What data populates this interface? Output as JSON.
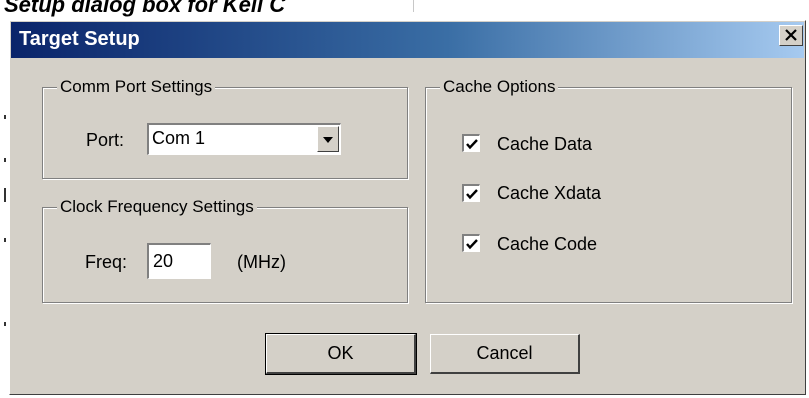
{
  "page": {
    "heading": "Setup dialog box for Keil C"
  },
  "dialog": {
    "title": "Target Setup",
    "close_glyph": "✕"
  },
  "comm_port": {
    "group_label": "Comm Port Settings",
    "port_label": "Port:",
    "port_value": "Com 1"
  },
  "clock": {
    "group_label": "Clock Frequency Settings",
    "freq_label": "Freq:",
    "freq_value": "20",
    "unit": "(MHz)"
  },
  "cache": {
    "group_label": "Cache Options",
    "options": [
      {
        "label": "Cache Data",
        "checked": true
      },
      {
        "label": "Cache Xdata",
        "checked": true
      },
      {
        "label": "Cache Code",
        "checked": true
      }
    ]
  },
  "buttons": {
    "ok_label": "OK",
    "cancel_label": "Cancel"
  },
  "colors": {
    "face": "#d4d0c8",
    "title_start": "#0a246a",
    "title_end": "#a6caf0"
  },
  "icons": {
    "close": "close-icon",
    "dropdown": "chevron-down-icon",
    "check": "checkmark-icon"
  }
}
